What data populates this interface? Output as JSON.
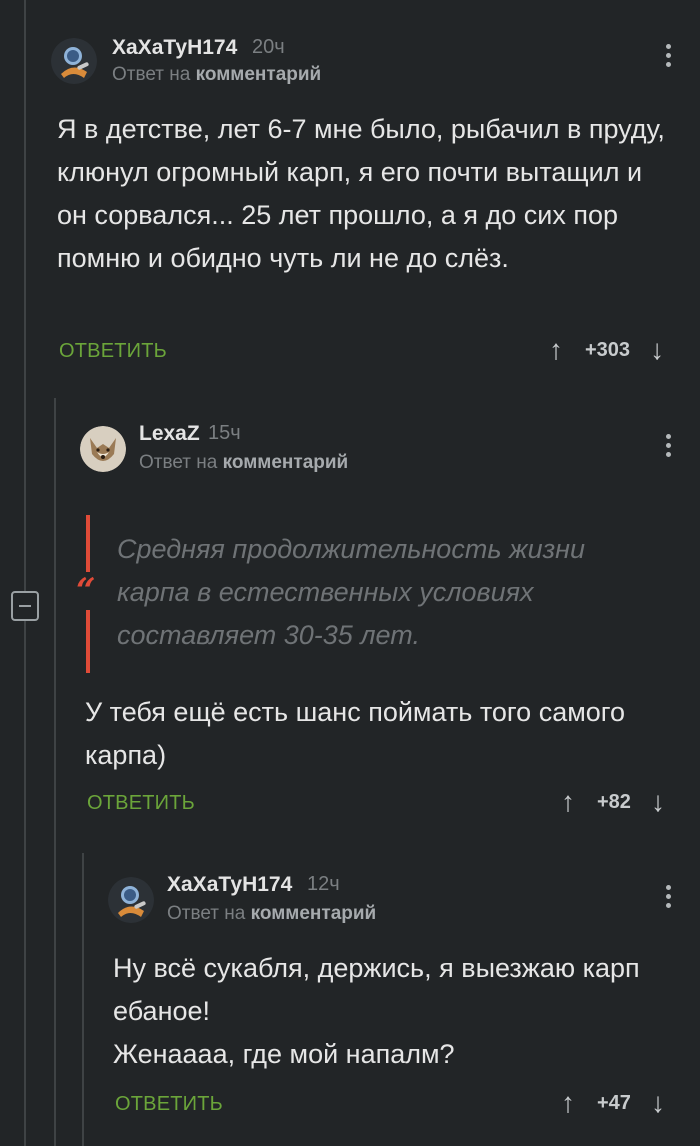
{
  "comments": [
    {
      "username": "ХаХаТуН174",
      "time": "20ч",
      "reply_prefix": "Ответ на",
      "reply_target": "комментарий",
      "text": "Я в детстве, лет 6-7 мне было, рыбачил в пруду, клюнул огромный карп, я его почти вытащил и он сорвался... 25 лет прошло, а я до сих пор помню и обидно чуть ли не до слёз.",
      "reply_label": "ОТВЕТИТЬ",
      "score": "+303",
      "avatar_icon": "astronaut-avatar-icon"
    },
    {
      "username": "LexaZ",
      "time": "15ч",
      "reply_prefix": "Ответ на",
      "reply_target": "комментарий",
      "quote": "Средняя продолжительность жизни карпа в естественных условиях составляет 30-35 лет.",
      "text": "У тебя ещё есть шанс поймать того самого карпа)",
      "reply_label": "ОТВЕТИТЬ",
      "score": "+82",
      "avatar_icon": "wolf-avatar-icon"
    },
    {
      "username": "ХаХаТуН174",
      "time": "12ч",
      "reply_prefix": "Ответ на",
      "reply_target": "комментарий",
      "text_lines": [
        "Ну всё сукабля, держись, я выезжаю карп ебаное!",
        "Женаааа, где мой напалм?"
      ],
      "reply_label": "ОТВЕТИТЬ",
      "score": "+47",
      "avatar_icon": "astronaut-avatar-icon"
    }
  ],
  "icons": {
    "upvote": "arrow-up-icon",
    "downvote": "arrow-down-icon",
    "menu": "more-vertical-icon",
    "collapse": "minus-square-icon",
    "quote": "quote-mark-icon"
  },
  "colors": {
    "background": "#222527",
    "reply_green": "#6ba53a",
    "quote_red": "#e04b38"
  }
}
